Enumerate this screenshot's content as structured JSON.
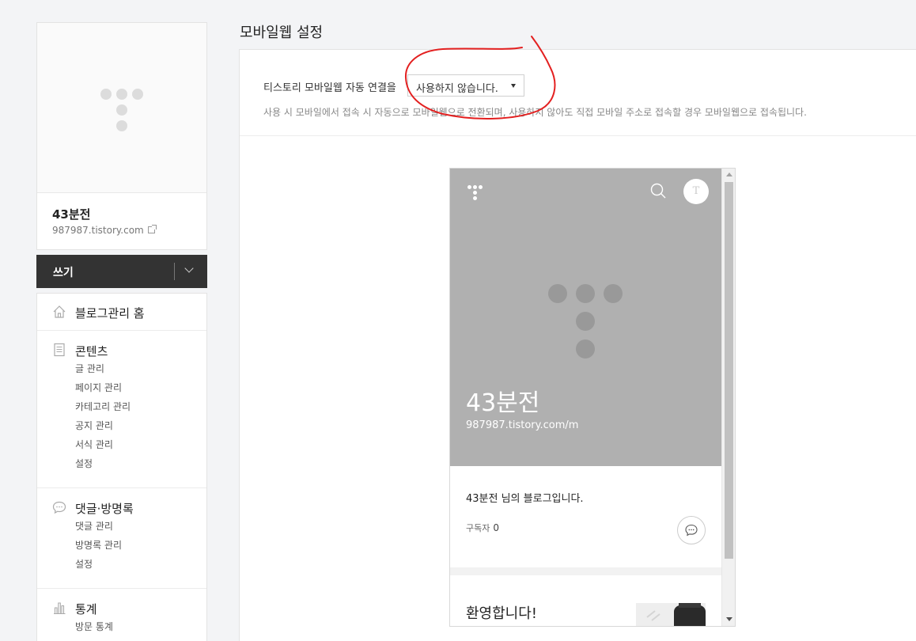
{
  "page": {
    "title": "모바일웹 설정"
  },
  "blog": {
    "name": "43분전",
    "url": "987987.tistory.com"
  },
  "write": {
    "label": "쓰기"
  },
  "menu": {
    "home": {
      "label": "블로그관리 홈",
      "icon": "home-icon"
    },
    "content": {
      "label": "콘텐츠",
      "icon": "document-icon",
      "items": [
        "글 관리",
        "페이지 관리",
        "카테고리 관리",
        "공지 관리",
        "서식 관리",
        "설정"
      ]
    },
    "comments": {
      "label": "댓글·방명록",
      "icon": "speech-bubble-icon",
      "items": [
        "댓글 관리",
        "방명록 관리",
        "설정"
      ]
    },
    "stats": {
      "label": "통계",
      "icon": "bar-chart-icon",
      "items": [
        "방문 통계"
      ]
    }
  },
  "setting": {
    "label": "티스토리 모바일웹 자동 연결을",
    "select_value": "사용하지 않습니다.",
    "description": "사용 시 모바일에서 접속 시 자동으로 모바일웹으로 전환되며, 사용하지 않아도 직접 모바일 주소로 접속할 경우 모바일웹으로 접속됩니다."
  },
  "preview": {
    "title": "43분전",
    "url": "987987.tistory.com/m",
    "profile_initial": "T",
    "intro": "43분전 님의 블로그입니다.",
    "subscribers_label": "구독자",
    "subscribers_count": "0",
    "welcome": "환영합니다!"
  },
  "colors": {
    "annotation": "#e32020",
    "hero_bg": "#b0b0b0",
    "write_bar": "#333333"
  }
}
